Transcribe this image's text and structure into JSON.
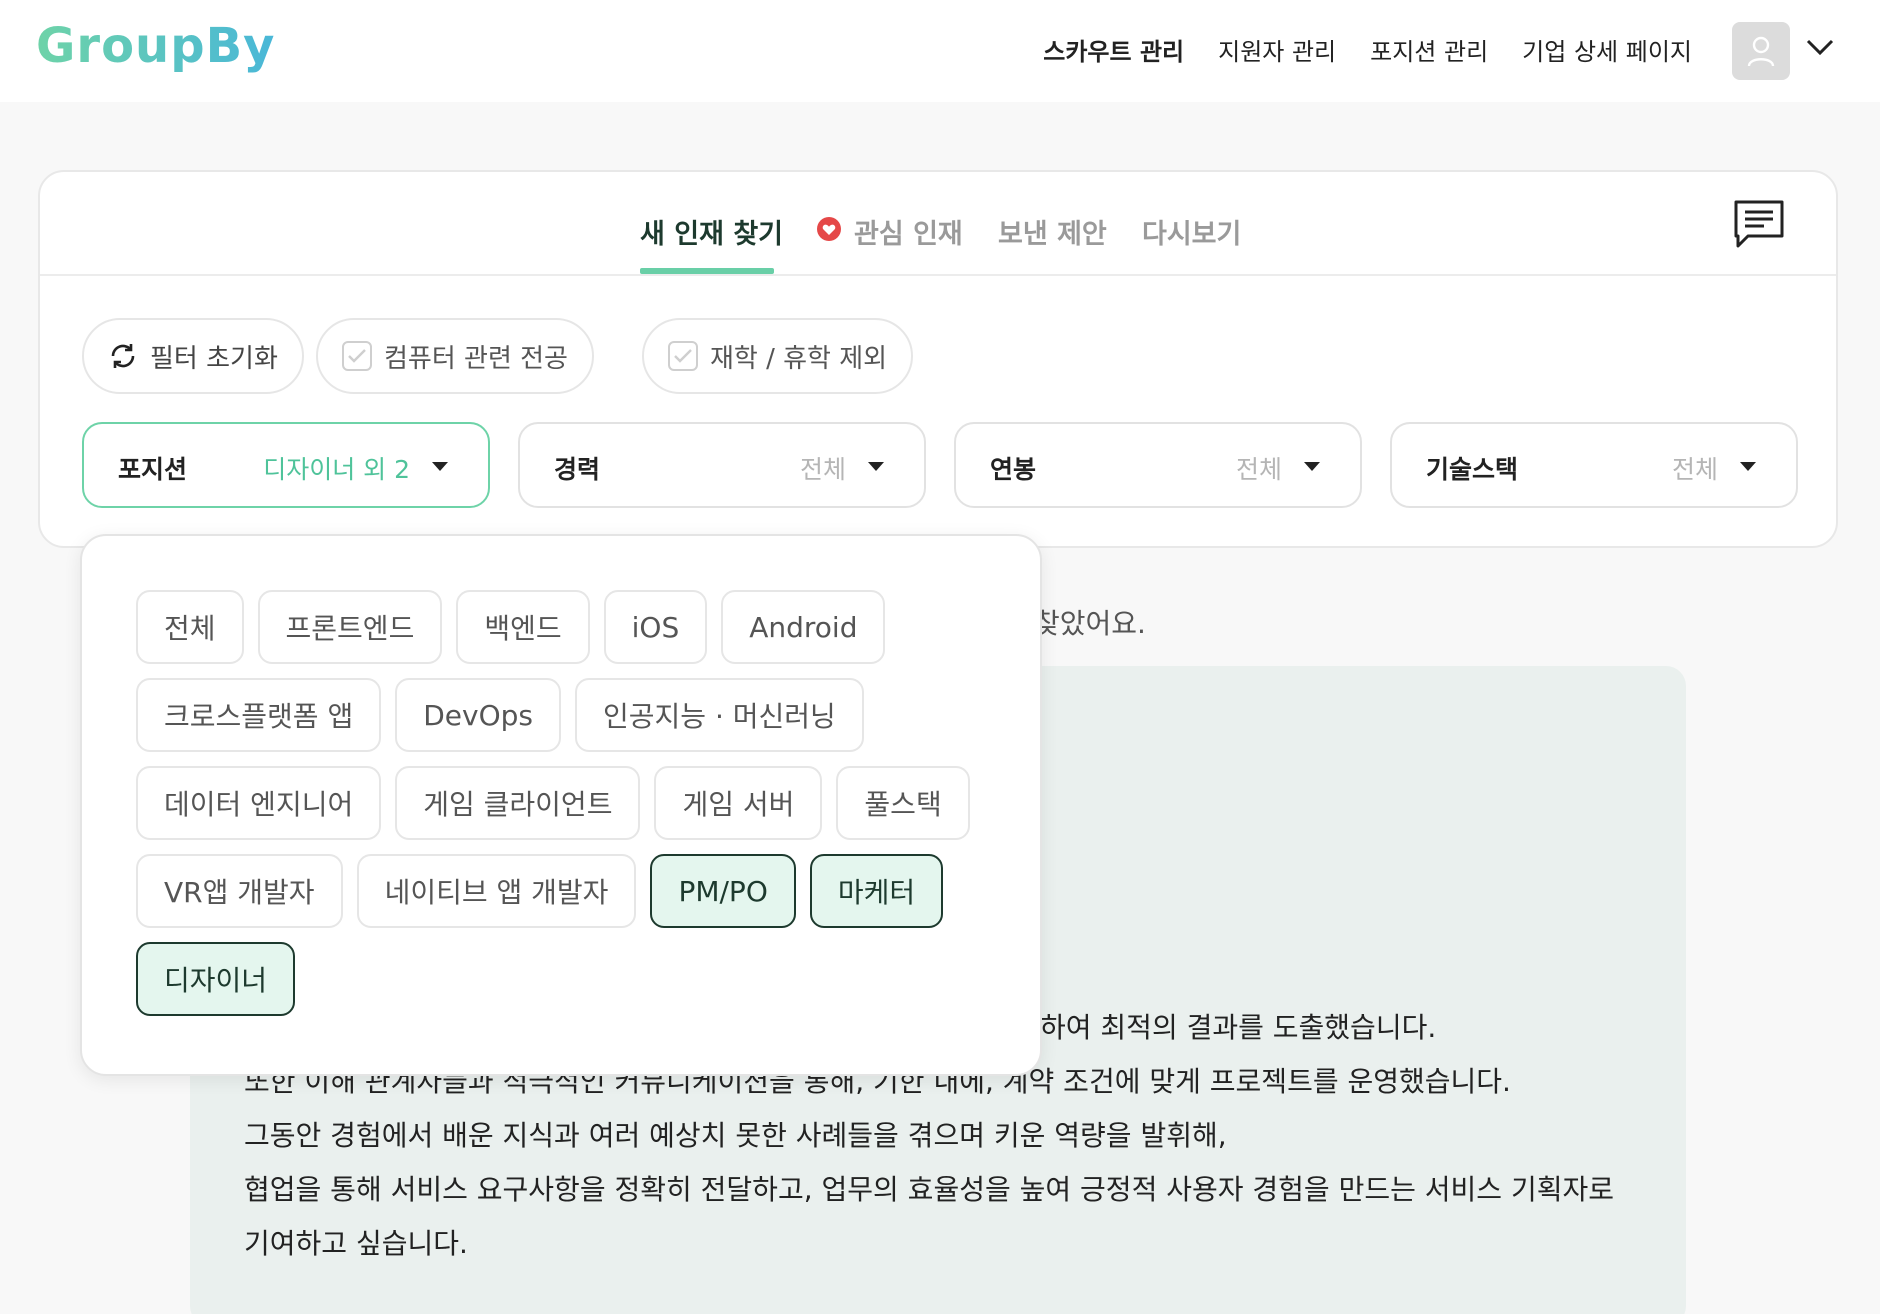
{
  "brand": {
    "logo": "GroupBy"
  },
  "nav": {
    "items": [
      {
        "label": "스카우트 관리",
        "active": true
      },
      {
        "label": "지원자 관리",
        "active": false
      },
      {
        "label": "포지션 관리",
        "active": false
      },
      {
        "label": "기업 상세 페이지",
        "active": false
      }
    ]
  },
  "tabs": [
    {
      "label": "새 인재 찾기",
      "active": true
    },
    {
      "label": "관심 인재",
      "active": false
    },
    {
      "label": "보낸 제안",
      "active": false
    },
    {
      "label": "다시보기",
      "active": false
    }
  ],
  "filters": {
    "reset": "필터 초기화",
    "cs_major": "컴퓨터 관련 전공",
    "exclude_students": "재학 / 휴학 제외"
  },
  "selects": [
    {
      "label": "포지션",
      "value": "디자이너 외 2",
      "active": true
    },
    {
      "label": "경력",
      "value": "전체",
      "active": false
    },
    {
      "label": "연봉",
      "value": "전체",
      "active": false
    },
    {
      "label": "기술스택",
      "value": "전체",
      "active": false
    }
  ],
  "position_options": [
    [
      {
        "label": "전체",
        "selected": false
      },
      {
        "label": "프론트엔드",
        "selected": false
      },
      {
        "label": "백엔드",
        "selected": false
      },
      {
        "label": "iOS",
        "selected": false
      },
      {
        "label": "Android",
        "selected": false
      }
    ],
    [
      {
        "label": "크로스플랫폼 앱",
        "selected": false
      },
      {
        "label": "DevOps",
        "selected": false
      },
      {
        "label": "인공지능 · 머신러닝",
        "selected": false
      }
    ],
    [
      {
        "label": "데이터 엔지니어",
        "selected": false
      },
      {
        "label": "게임 클라이언트",
        "selected": false
      },
      {
        "label": "게임 서버",
        "selected": false
      },
      {
        "label": "풀스택",
        "selected": false
      }
    ],
    [
      {
        "label": "VR앱 개발자",
        "selected": false
      },
      {
        "label": "네이티브 앱 개발자",
        "selected": false
      },
      {
        "label": "PM/PO",
        "selected": true
      },
      {
        "label": "마케터",
        "selected": true
      }
    ],
    [
      {
        "label": "디자이너",
        "selected": true
      }
    ]
  ],
  "background": {
    "found_text": "찾았어요.",
    "lines": [
      "하여 최적의 결과를 도출했습니다.",
      "또한 이해 관계자들과 적극적인 커뮤니케이션을 통해, 기한 내에, 계약 조건에 맞게 프로젝트를 운영했습니다.",
      "그동안 경험에서 배운 지식과 여러 예상치 못한 사례들을 겪으며 키운 역량을 발휘해,",
      "협업을 통해 서비스 요구사항을 정확히 전달하고, 업무의 효율성을 높여 긍정적 사용자 경험을 만드는 서비스 기획자로",
      "기여하고 싶습니다."
    ]
  },
  "colors": {
    "accent": "#6ed3a8",
    "selected_chip_bg": "#e4f6ee",
    "dark_green": "#1d3a2e",
    "heart": "#e54848"
  }
}
